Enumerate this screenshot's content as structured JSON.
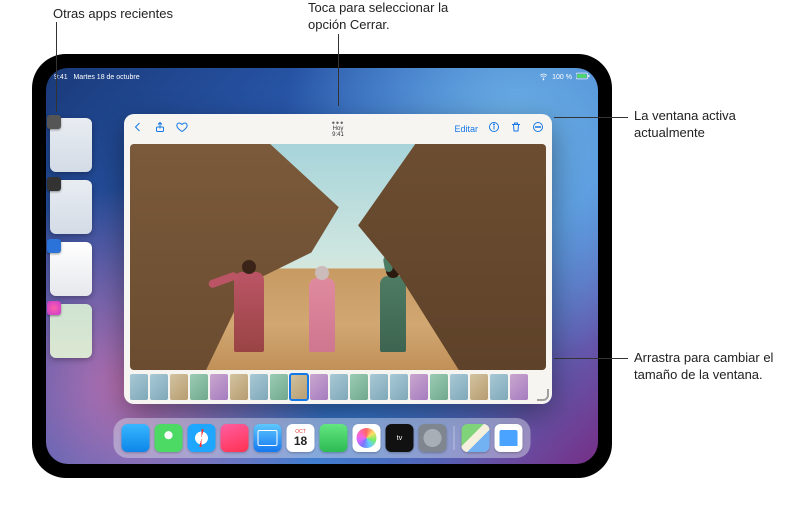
{
  "callouts": {
    "recent_apps": "Otras apps recientes",
    "close_option": "Toca para seleccionar la opción Cerrar.",
    "active_window": "La ventana activa actualmente",
    "resize": "Arrastra para cambiar el tamaño de la ventana."
  },
  "statusbar": {
    "time": "9:41",
    "date": "Martes 18 de octubre",
    "battery": "100 %"
  },
  "photos_window": {
    "title": "Hoy",
    "subtitle": "9:41",
    "edit_label": "Editar"
  },
  "calendar_icon": {
    "month": "OCT",
    "day": "18"
  },
  "tv_icon_label": "tv"
}
